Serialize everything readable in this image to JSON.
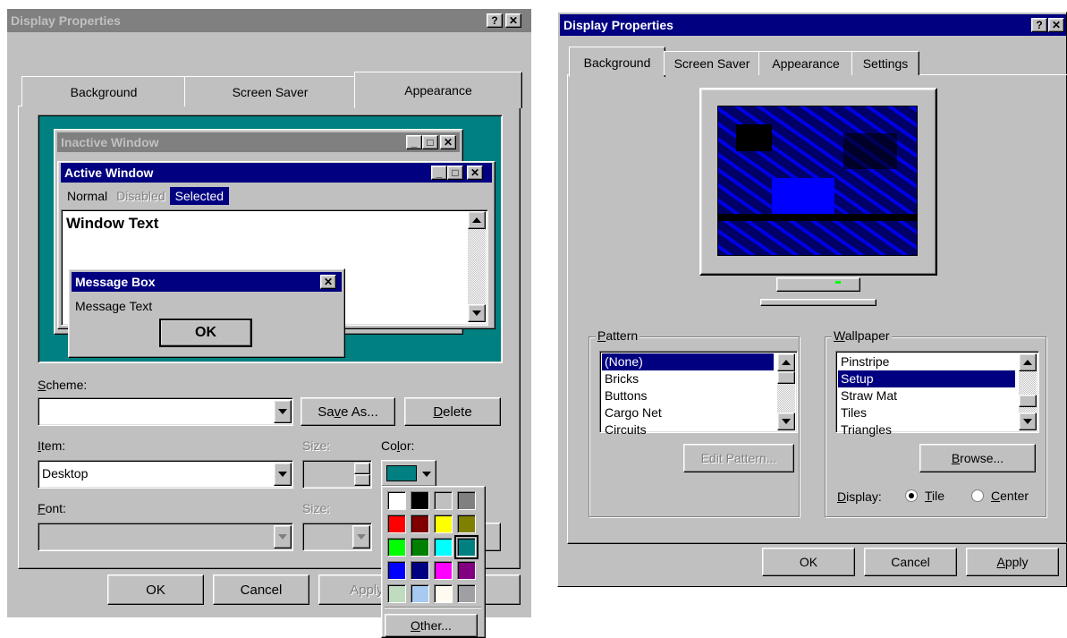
{
  "left_dialog": {
    "title": "Display Properties",
    "help_btn": "?",
    "close_btn": "✕",
    "tabs": [
      "Background",
      "Screen Saver",
      "Appearance"
    ],
    "preview": {
      "inactive_title": "Inactive Window",
      "active_title": "Active Window",
      "menu_normal": "Normal",
      "menu_disabled": "Disabled",
      "menu_selected": "Selected",
      "window_text": "Window Text",
      "msgbox_title": "Message Box",
      "msgbox_text": "Message Text",
      "msgbox_ok": "OK"
    },
    "scheme_label": "Scheme:",
    "scheme_value": "",
    "save_as": "Save As...",
    "delete": "Delete",
    "item_label": "Item:",
    "item_value": "Desktop",
    "size_label": "Size:",
    "color_label": "Color:",
    "font_label": "Font:",
    "font_size_label": "Size:",
    "ok": "OK",
    "cancel": "Cancel",
    "apply": "Apply",
    "color_popup": {
      "other": "Other...",
      "colors": [
        "#ffffff",
        "#000000",
        "#c0c0c0",
        "#808080",
        "#ff0000",
        "#800000",
        "#ffff00",
        "#808000",
        "#00ff00",
        "#008000",
        "#00ffff",
        "#008080",
        "#0000ff",
        "#000080",
        "#ff00ff",
        "#800080",
        "#c0dcc0",
        "#a6caf0",
        "#fffbf0",
        "#a0a0a4"
      ],
      "selected_index": 11
    },
    "desktop_color": "#008080"
  },
  "right_dialog": {
    "title": "Display Properties",
    "help_btn": "?",
    "close_btn": "✕",
    "tabs": [
      "Background",
      "Screen Saver",
      "Appearance",
      "Settings"
    ],
    "pattern_label": "Pattern",
    "patterns": [
      "(None)",
      "Bricks",
      "Buttons",
      "Cargo Net",
      "Circuits"
    ],
    "edit_pattern": "Edit Pattern...",
    "wallpaper_label": "Wallpaper",
    "wallpapers": [
      "Pinstripe",
      "Setup",
      "Straw Mat",
      "Tiles",
      "Triangles"
    ],
    "browse": "Browse...",
    "display_label": "Display:",
    "tile": "Tile",
    "center": "Center",
    "ok": "OK",
    "cancel": "Cancel",
    "apply": "Apply"
  },
  "colors": {
    "title_active": "#000080",
    "title_inactive": "#808080",
    "face": "#c0c0c0"
  }
}
